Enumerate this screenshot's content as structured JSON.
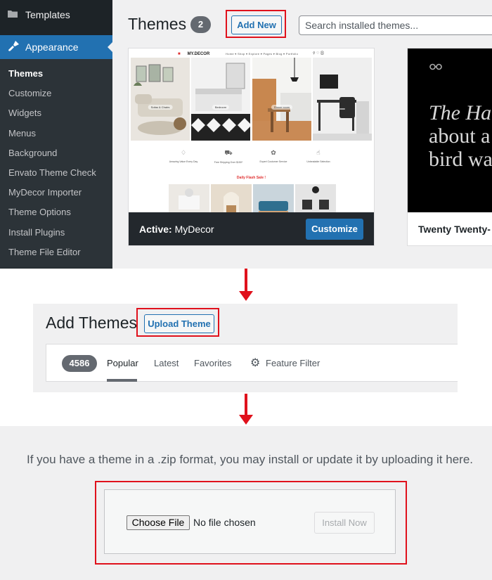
{
  "sidebar": {
    "templates_label": "Templates",
    "appearance_label": "Appearance",
    "items": [
      {
        "label": "Themes",
        "current": true
      },
      {
        "label": "Customize"
      },
      {
        "label": "Widgets"
      },
      {
        "label": "Menus"
      },
      {
        "label": "Background"
      },
      {
        "label": "Envato Theme Check"
      },
      {
        "label": "MyDecor Importer"
      },
      {
        "label": "Theme Options"
      },
      {
        "label": "Install Plugins"
      },
      {
        "label": "Theme File Editor"
      }
    ]
  },
  "themes_page": {
    "title": "Themes",
    "count": "2",
    "add_new_label": "Add New",
    "search_placeholder": "Search installed themes...",
    "active_theme": {
      "active_prefix": "Active:",
      "name": "MyDecor",
      "customize_label": "Customize",
      "preview": {
        "logo": "MY.DECOR",
        "nav": "Home ▾   Shop ▾   Explore ▾   Pages ▾   Blog ▾   Portfolio",
        "slides": [
          "Sofas & Chairs",
          "Bedroom",
          "Dinner room",
          ""
        ],
        "features": [
          "Amazing Value Every Day",
          "Free Shipping Over $150*",
          "Expert Customer Service",
          "Unbeatable Selection"
        ],
        "flash_sale": "Daily Flash Sale !"
      }
    },
    "second_theme": {
      "name": "Twenty Twenty-",
      "preview_lines": [
        "The Ha",
        "about a",
        "bird wa"
      ]
    }
  },
  "add_themes_page": {
    "title": "Add Themes",
    "upload_label": "Upload Theme",
    "count": "4586",
    "tabs": [
      "Popular",
      "Latest",
      "Favorites"
    ],
    "feature_filter_label": "Feature Filter"
  },
  "upload_panel": {
    "help_text": "If you have a theme in a .zip format, you may install or update it by uploading it here.",
    "choose_file_label": "Choose File",
    "no_file_text": "No file chosen",
    "install_now_label": "Install Now"
  },
  "colors": {
    "highlight": "#e0111c",
    "wp_blue": "#2271b1",
    "admin_dark": "#1d2327",
    "admin_bg": "#f0f0f1"
  }
}
